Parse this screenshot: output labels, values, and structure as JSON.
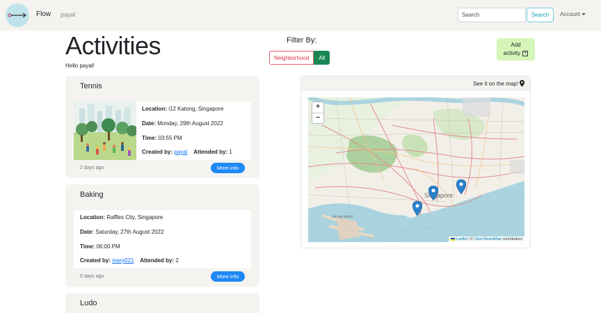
{
  "nav": {
    "brand": "Flow",
    "user": "payal",
    "search_placeholder": "Search",
    "search_button": "Search",
    "account": "Account"
  },
  "page": {
    "title": "Activities",
    "greeting": "Hello payal!",
    "filter_label": "Filter By:",
    "filters": [
      "Neighborhood",
      "All"
    ],
    "active_filter": "All",
    "add_activity_line1": "Add",
    "add_activity_line2": "activity"
  },
  "labels": {
    "location": "Location:",
    "date": "Date:",
    "time": "Time:",
    "created_by": "Created by:",
    "attended_by": "Attended by:",
    "more_info": "More info"
  },
  "activities": [
    {
      "title": "Tennis",
      "location": "i12 Katong, Singapore",
      "date": "Monday, 29th August 2022",
      "time": "03:55 PM",
      "created_by": "payal",
      "attended_by": "1",
      "ago": "2 days ago",
      "has_image": true
    },
    {
      "title": "Baking",
      "location": "Raffles City, Singapore",
      "date": "Saturday, 27th August 2022",
      "time": "06:00 PM",
      "created_by": "mary021",
      "attended_by": "2",
      "ago": "5 days ago",
      "has_image": false
    },
    {
      "title": "Ludo"
    }
  ],
  "map": {
    "caption": "See it on the map!",
    "zoom_in": "+",
    "zoom_out": "−",
    "city_label": "Singapore",
    "area_label": "Jurong Island",
    "attribution_leaflet": "Leaflet",
    "attribution_sep": "| ©",
    "attribution_osm": "OpenStreetMap",
    "attribution_tail": "contributors",
    "marker_color": "#2a81cb"
  },
  "colors": {
    "navbar": "#f4f3f0",
    "filter_active": "#198754",
    "filter_outline": "#dc3545",
    "add_button": "#d6f5b9",
    "more_info": "#1e88f5"
  }
}
